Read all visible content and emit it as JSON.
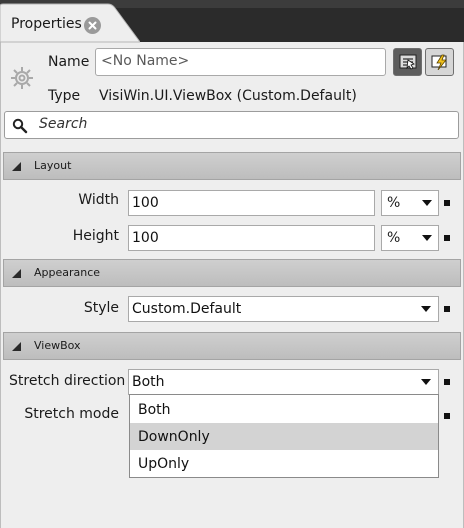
{
  "tab": {
    "label": "Properties",
    "close_icon": "close-icon"
  },
  "object": {
    "name_label": "Name",
    "name_placeholder": "<No Name>",
    "type_label": "Type",
    "type_value": "VisiWin.UI.ViewBox (Custom.Default)"
  },
  "toolbar": {
    "properties_icon": "properties-view-icon",
    "events_icon": "events-lightning-icon"
  },
  "search": {
    "placeholder": "Search"
  },
  "sections": {
    "layout": {
      "title": "Layout",
      "width_label": "Width",
      "width_value": "100",
      "width_unit": "%",
      "height_label": "Height",
      "height_value": "100",
      "height_unit": "%"
    },
    "appearance": {
      "title": "Appearance",
      "style_label": "Style",
      "style_value": "Custom.Default"
    },
    "viewbox": {
      "title": "ViewBox",
      "stretch_direction_label": "Stretch direction",
      "stretch_direction_value": "Both",
      "stretch_mode_label": "Stretch mode",
      "options": [
        "Both",
        "DownOnly",
        "UpOnly"
      ],
      "highlighted_option": "DownOnly"
    }
  },
  "colors": {
    "panel_bg": "#eeeeee",
    "section_header": "#c6c6c6",
    "dark_frame": "#2b2b2b",
    "highlight": "#d3d3d3"
  }
}
